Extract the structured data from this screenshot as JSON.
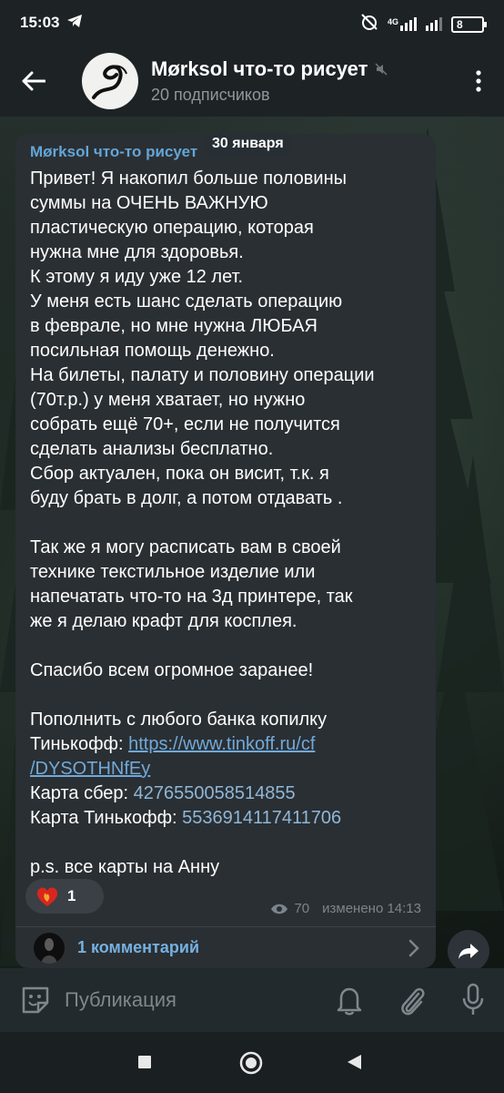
{
  "status_bar": {
    "time": "15:03",
    "network": "4G",
    "battery": "8"
  },
  "header": {
    "channel_title": "Mørksol что-то рисует",
    "subscribers": "20 подписчиков"
  },
  "date_pill": "30 января",
  "message": {
    "author": "Mørksol что-то рисует",
    "text": "Привет! Я накопил больше половины\nсуммы на ОЧЕНЬ ВАЖНУЮ\nпластическую операцию, которая\nнужна мне для здоровья.\nК этому я иду уже 12 лет.\nУ меня есть шанс сделать операцию\nв феврале, но мне нужна ЛЮБАЯ\nпосильная помощь денежно.\nНа билеты, палату и половину операции\n(70т.р.) у меня хватает, но нужно\nсобрать ещё 70+, если не получится\nсделать анализы бесплатно.\nСбор актуален, пока он висит, т.к. я\nбуду брать в долг, а потом отдавать .\n\nТак же я могу расписать вам в своей\nтехнике текстильное изделие или\nнапечатать что-то на 3д принтере, так\nже я делаю крафт для косплея.\n\nСпасибо всем огромное заранее!\n\nПополнить с любого банка копилку",
    "tinkoff_label": "Тинькофф: ",
    "link_line1": "https://www.tinkoff.ru/cf",
    "link_line2": "/DYSOTHNfEy",
    "sber_label": "Карта сбер: ",
    "sber_card": "4276550058514855",
    "tinkoff_card_label": "Карта Тинькофф: ",
    "tinkoff_card": "5536914117411706",
    "ps": "p.s. все карты на Анну",
    "reaction_count": "1",
    "views": "70",
    "edited": "изменено 14:13",
    "comments_label": "1 комментарий"
  },
  "composer": {
    "placeholder": "Публикация"
  },
  "colors": {
    "accent_link": "#71a9d9",
    "bubble": "#2a2f33",
    "header": "#1d2325"
  }
}
